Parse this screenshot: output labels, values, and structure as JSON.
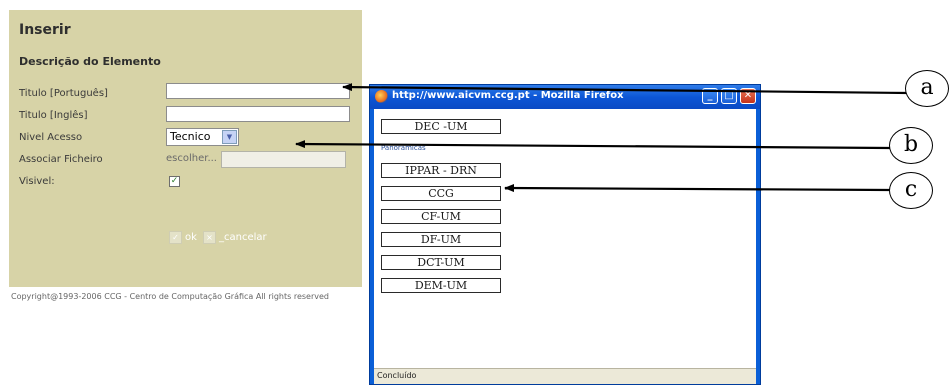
{
  "form": {
    "title": "Inserir",
    "subtitle": "Descrição do Elemento",
    "fields": [
      {
        "label": "Titulo [Português]",
        "value": ""
      },
      {
        "label": "Titulo [Inglês]",
        "value": ""
      },
      {
        "label": "Nivel Acesso",
        "value": "Tecnico"
      },
      {
        "label": "Associar Ficheiro",
        "value": "escolher..."
      },
      {
        "label": "Visivel:",
        "value": "✓"
      }
    ],
    "ok_label": "ok",
    "cancel_label": "_cancelar",
    "copyright": "Copyright@1993-2006 CCG - Centro de Computação Gráfica All rights reserved"
  },
  "popup": {
    "title": "http://www.aicvm.ccg.pt - Mozilla Firefox",
    "buttons": [
      "DEC -UM",
      "IPPAR - DRN",
      "CCG",
      "CF-UM",
      "DF-UM",
      "DCT-UM",
      "DEM-UM"
    ],
    "link": "Panoramicas",
    "status": "Concluído"
  },
  "callouts": [
    "a",
    "b",
    "c"
  ],
  "colors": {
    "form_bg": "#d7d3a7",
    "titlebar": "#0c56d6"
  }
}
